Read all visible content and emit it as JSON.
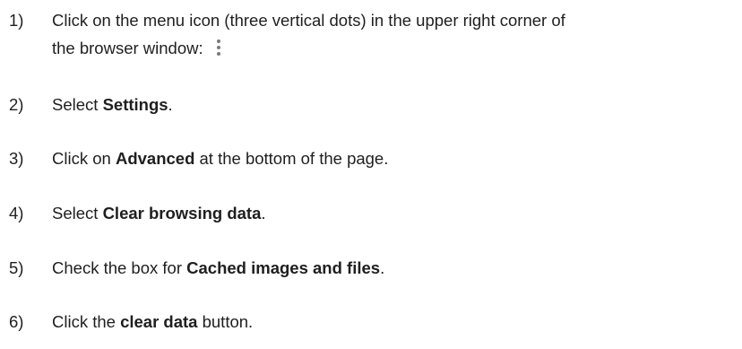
{
  "steps": [
    {
      "number": "1)",
      "line1": "Click on the menu icon (three vertical dots) in the upper right corner of",
      "line2": "the browser window:",
      "icon": "three-vertical-dots-icon"
    },
    {
      "number": "2)",
      "pre": "Select ",
      "bold": "Settings",
      "post": "."
    },
    {
      "number": "3)",
      "pre": "Click on ",
      "bold": "Advanced",
      "post": " at the bottom of the page."
    },
    {
      "number": "4)",
      "pre": "Select ",
      "bold": "Clear browsing data",
      "post": "."
    },
    {
      "number": "5)",
      "pre": "Check the box for ",
      "bold": "Cached images and files",
      "post": "."
    },
    {
      "number": "6)",
      "pre": "Click the ",
      "bold": "clear data",
      "post": " button."
    }
  ]
}
